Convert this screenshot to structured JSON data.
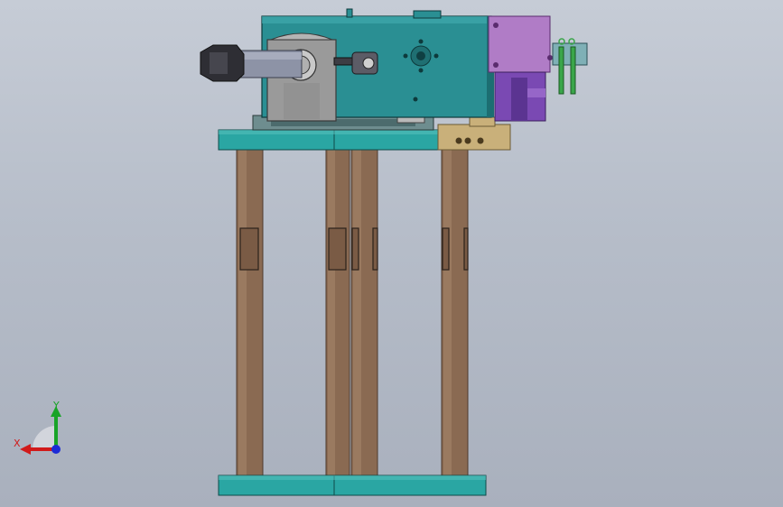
{
  "scene": {
    "background_colors": [
      "#c6ccd6",
      "#a9b0bd"
    ],
    "part_colors": {
      "teal_plate": "#2aa6a3",
      "teal_dark": "#1c7d7b",
      "column_brown": "#8a6a52",
      "column_light": "#a8866b",
      "cylinder_gray": "#8d93a6",
      "block_teal": "#2a8f93",
      "bracket_gray": "#9a9a9a",
      "purple_block": "#b07cc6",
      "violet_part": "#7a49b3",
      "tan_plate": "#c9b07a",
      "green_pins": "#3aa64a"
    }
  },
  "triad": {
    "x_label": "X",
    "y_label": "Y",
    "x_color": "#d11a1a",
    "y_color": "#18a327",
    "z_color": "#1c2bd6"
  }
}
